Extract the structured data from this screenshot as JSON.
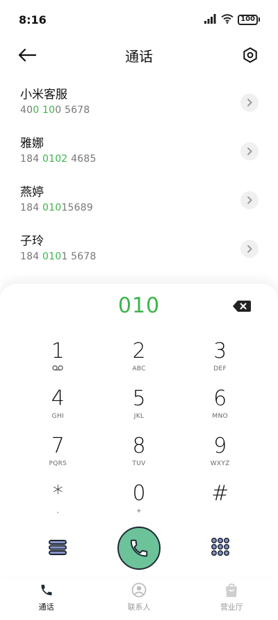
{
  "status_bar": {
    "time": "8:16",
    "battery": "100",
    "icons": [
      "signal-icon",
      "wifi-icon",
      "battery-icon"
    ]
  },
  "header": {
    "title": "通话",
    "back_icon": "arrow-left-icon",
    "settings_icon": "hexagon-settings-icon"
  },
  "contacts": [
    {
      "name": "小米客服",
      "number_parts": [
        "40",
        "0",
        " ",
        "10",
        "0 5678"
      ]
    },
    {
      "name": "雅娜",
      "number_parts": [
        "184 ",
        "0102",
        " 4685"
      ]
    },
    {
      "name": "燕婷",
      "number_parts": [
        "184 ",
        "010",
        "15689"
      ]
    },
    {
      "name": "子玲",
      "number_parts": [
        "184 ",
        "010",
        "1 5678"
      ]
    }
  ],
  "dialpad": {
    "dialed": "010",
    "keys": [
      {
        "digit": "1",
        "sub": ""
      },
      {
        "digit": "2",
        "sub": "ABC"
      },
      {
        "digit": "3",
        "sub": "DEF"
      },
      {
        "digit": "4",
        "sub": "GHI"
      },
      {
        "digit": "5",
        "sub": "JKL"
      },
      {
        "digit": "6",
        "sub": "MNO"
      },
      {
        "digit": "7",
        "sub": "PQRS"
      },
      {
        "digit": "8",
        "sub": "TUV"
      },
      {
        "digit": "9",
        "sub": "WXYZ"
      },
      {
        "digit": "*",
        "sub": ","
      },
      {
        "digit": "0",
        "sub": "+"
      },
      {
        "digit": "#",
        "sub": ""
      }
    ]
  },
  "bottom_nav": {
    "items": [
      {
        "label": "通话",
        "active": true
      },
      {
        "label": "联系人",
        "active": false
      },
      {
        "label": "营业厅",
        "active": false
      }
    ]
  },
  "colors": {
    "accent_green": "#3cb44b",
    "call_button": "#6cc39a",
    "dark": "#1f2a33"
  }
}
